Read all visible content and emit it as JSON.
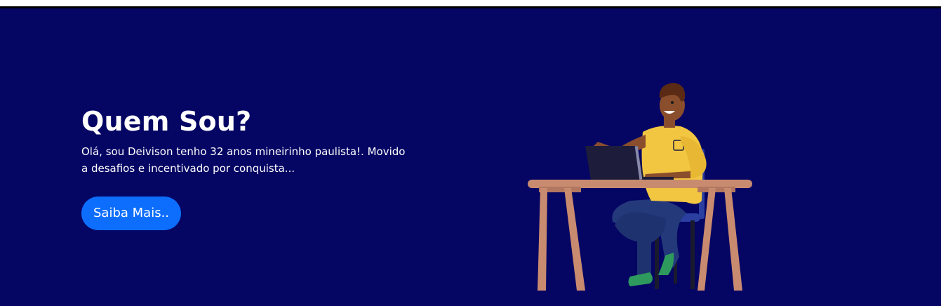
{
  "hero": {
    "title": "Quem Sou?",
    "description": "Olá, sou Deivison tenho 32 anos mineirinho paulista!. Movido a desafios e incentivado por conquista...",
    "cta_label": "Saiba Mais.."
  },
  "colors": {
    "background": "#050564",
    "cta": "#0d6efd",
    "text": "#ffffff",
    "shirt": "#f2c641",
    "desk": "#c98b6f",
    "pants": "#23397a",
    "laptop": "#1d1d3b",
    "shoes": "#2e9a5e"
  },
  "illustration": {
    "icon": "person-at-desk-laptop-illustration"
  }
}
